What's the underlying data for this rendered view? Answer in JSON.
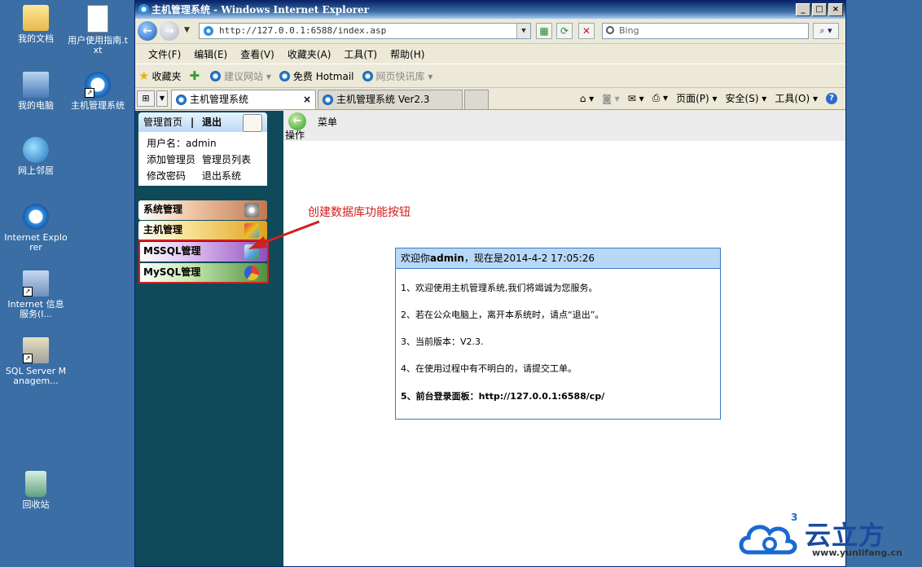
{
  "desktop": {
    "icons": [
      {
        "label": "我的文档"
      },
      {
        "label": "用户使用指南.txt"
      },
      {
        "label": "我的电脑"
      },
      {
        "label": "主机管理系统"
      },
      {
        "label": "网上邻居"
      },
      {
        "label": "Internet Explorer"
      },
      {
        "label": "Internet 信息服务(I..."
      },
      {
        "label": "SQL Server Managem..."
      },
      {
        "label": "回收站"
      }
    ]
  },
  "window": {
    "title": "主机管理系统 - Windows Internet Explorer",
    "controls": [
      "_",
      "□",
      "×"
    ]
  },
  "address": {
    "url": "http://127.0.0.1:6588/index.asp",
    "search_placeholder": "Bing"
  },
  "menubar": [
    "文件(F)",
    "编辑(E)",
    "查看(V)",
    "收藏夹(A)",
    "工具(T)",
    "帮助(H)"
  ],
  "favbar": {
    "favorites": "收藏夹",
    "items": [
      "建议网站 ▾",
      "免费 Hotmail",
      "网页快讯库 ▾"
    ]
  },
  "tabs": [
    {
      "label": "主机管理系统",
      "active": true,
      "close": "×"
    },
    {
      "label": "主机管理系统 Ver2.3",
      "active": false
    }
  ],
  "tabtools": {
    "page": "页面(P) ▾",
    "security": "安全(S) ▾",
    "tools": "工具(O) ▾",
    "help": "?"
  },
  "leftpane": {
    "home": "管理首页",
    "sep": "|",
    "logout": "退出",
    "username": "用户名：admin",
    "links": [
      "添加管理员",
      "管理员列表",
      "修改密码",
      "退出系统"
    ],
    "buttons": [
      "系统管理",
      "主机管理",
      "MSSQL管理",
      "MySQL管理"
    ]
  },
  "mainbar": {
    "label": "菜单操作"
  },
  "annotation": "创建数据库功能按钮",
  "welcome": {
    "header_prefix": "欢迎你",
    "user": "admin",
    "header_suffix": "，现在是2014-4-2 17:05:26",
    "lines": [
      "1、欢迎使用主机管理系统,我们将竭诚为您服务。",
      "2、若在公众电脑上，离开本系统时，请点“退出”。",
      "3、当前版本：V2.3.",
      "4、在使用过程中有不明白的，请提交工单。",
      "5、前台登录面板：http://127.0.0.1:6588/cp/"
    ]
  },
  "watermark": {
    "brand": "云立方",
    "url": "www.yunlifang.cn",
    "sup": "3"
  }
}
